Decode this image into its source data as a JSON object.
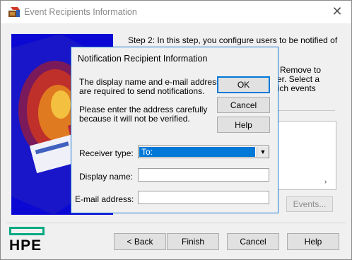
{
  "window": {
    "title": "Event Recipients Information",
    "app_icon": "setup-icon",
    "close_glyph": "✕"
  },
  "wizard": {
    "step_text_line1": "Step 2:  In this step, you configure users to be notified of",
    "bg_text_1": "e Remove to",
    "bg_text_2": "ser. Select a",
    "bg_text_3": "hich events",
    "events_button": "Events...",
    "scroll_right_glyph": "›",
    "logo_text": "HPE",
    "back_button": "< Back",
    "finish_button": "Finish",
    "cancel_button": "Cancel",
    "help_button": "Help"
  },
  "dialog": {
    "title": "Notification Recipient Information",
    "info_line1": "The display name and e-mail address",
    "info_line2": "are required to send notifications.",
    "warn_line1": "Please enter the address carefully",
    "warn_line2": "because it will not be verified.",
    "ok_button": "OK",
    "cancel_button": "Cancel",
    "help_button": "Help",
    "receiver_type_label": "Receiver type:",
    "receiver_type_value": "To:",
    "display_name_label": "Display name:",
    "display_name_value": "",
    "email_label": "E-mail address:",
    "email_value": ""
  },
  "colors": {
    "accent": "#0078d7",
    "hpe_green": "#01a982"
  }
}
